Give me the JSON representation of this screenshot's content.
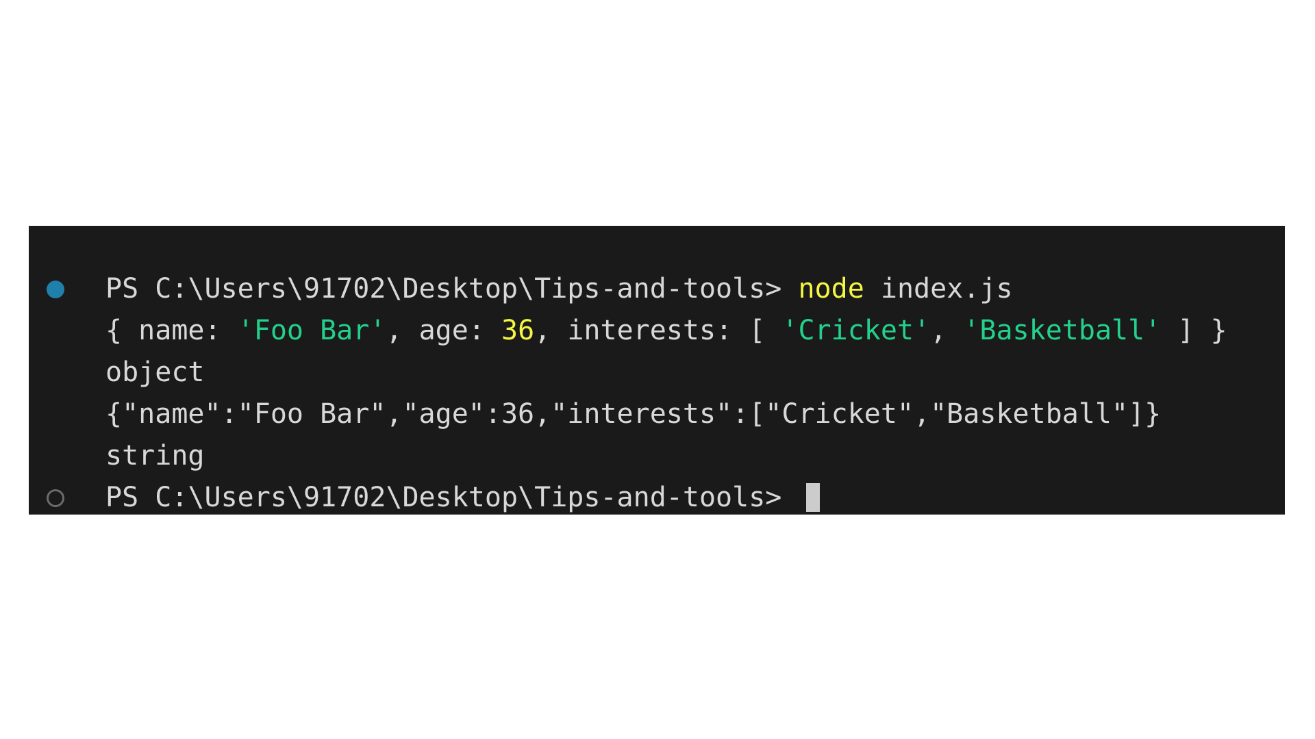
{
  "window": {
    "background_color": "#ffffff",
    "terminal_background": "#1a1a1a",
    "default_text_color": "#d8d8d8",
    "string_color": "#23d18b",
    "number_color": "#f5f543",
    "command_color": "#f5f543",
    "cursor_color": "#cccccc",
    "marker_active_color": "#1f81ab",
    "marker_idle_color": "#6b6b6b"
  },
  "terminal": {
    "shell": "PS",
    "prompt_path": "C:\\Users\\91702\\Desktop\\Tips-and-tools",
    "prompt_suffix": ">",
    "lines": [
      {
        "id": "line-command",
        "marker": "filled",
        "tokens": [
          {
            "text": "PS C:\\Users\\91702\\Desktop\\Tips-and-tools> ",
            "type": "prompt"
          },
          {
            "text": "node",
            "type": "cmd"
          },
          {
            "text": " index.js",
            "type": "default"
          }
        ]
      },
      {
        "id": "line-object-output",
        "marker": "none",
        "tokens": [
          {
            "text": "{ name: ",
            "type": "default"
          },
          {
            "text": "'Foo Bar'",
            "type": "string"
          },
          {
            "text": ", age: ",
            "type": "default"
          },
          {
            "text": "36",
            "type": "number"
          },
          {
            "text": ", interests: [ ",
            "type": "default"
          },
          {
            "text": "'Cricket'",
            "type": "string"
          },
          {
            "text": ", ",
            "type": "default"
          },
          {
            "text": "'Basketball'",
            "type": "string"
          },
          {
            "text": " ] }",
            "type": "default"
          }
        ]
      },
      {
        "id": "line-typeof-object",
        "marker": "none",
        "tokens": [
          {
            "text": "object",
            "type": "default"
          }
        ]
      },
      {
        "id": "line-json-output",
        "marker": "none",
        "tokens": [
          {
            "text": "{\"name\":\"Foo Bar\",\"age\":36,\"interests\":[\"Cricket\",\"Basketball\"]}",
            "type": "default"
          }
        ]
      },
      {
        "id": "line-typeof-string",
        "marker": "none",
        "tokens": [
          {
            "text": "string",
            "type": "default"
          }
        ]
      },
      {
        "id": "line-final-prompt",
        "marker": "hollow",
        "cursor": true,
        "tokens": [
          {
            "text": "PS C:\\Users\\91702\\Desktop\\Tips-and-tools> ",
            "type": "prompt"
          }
        ]
      }
    ]
  }
}
